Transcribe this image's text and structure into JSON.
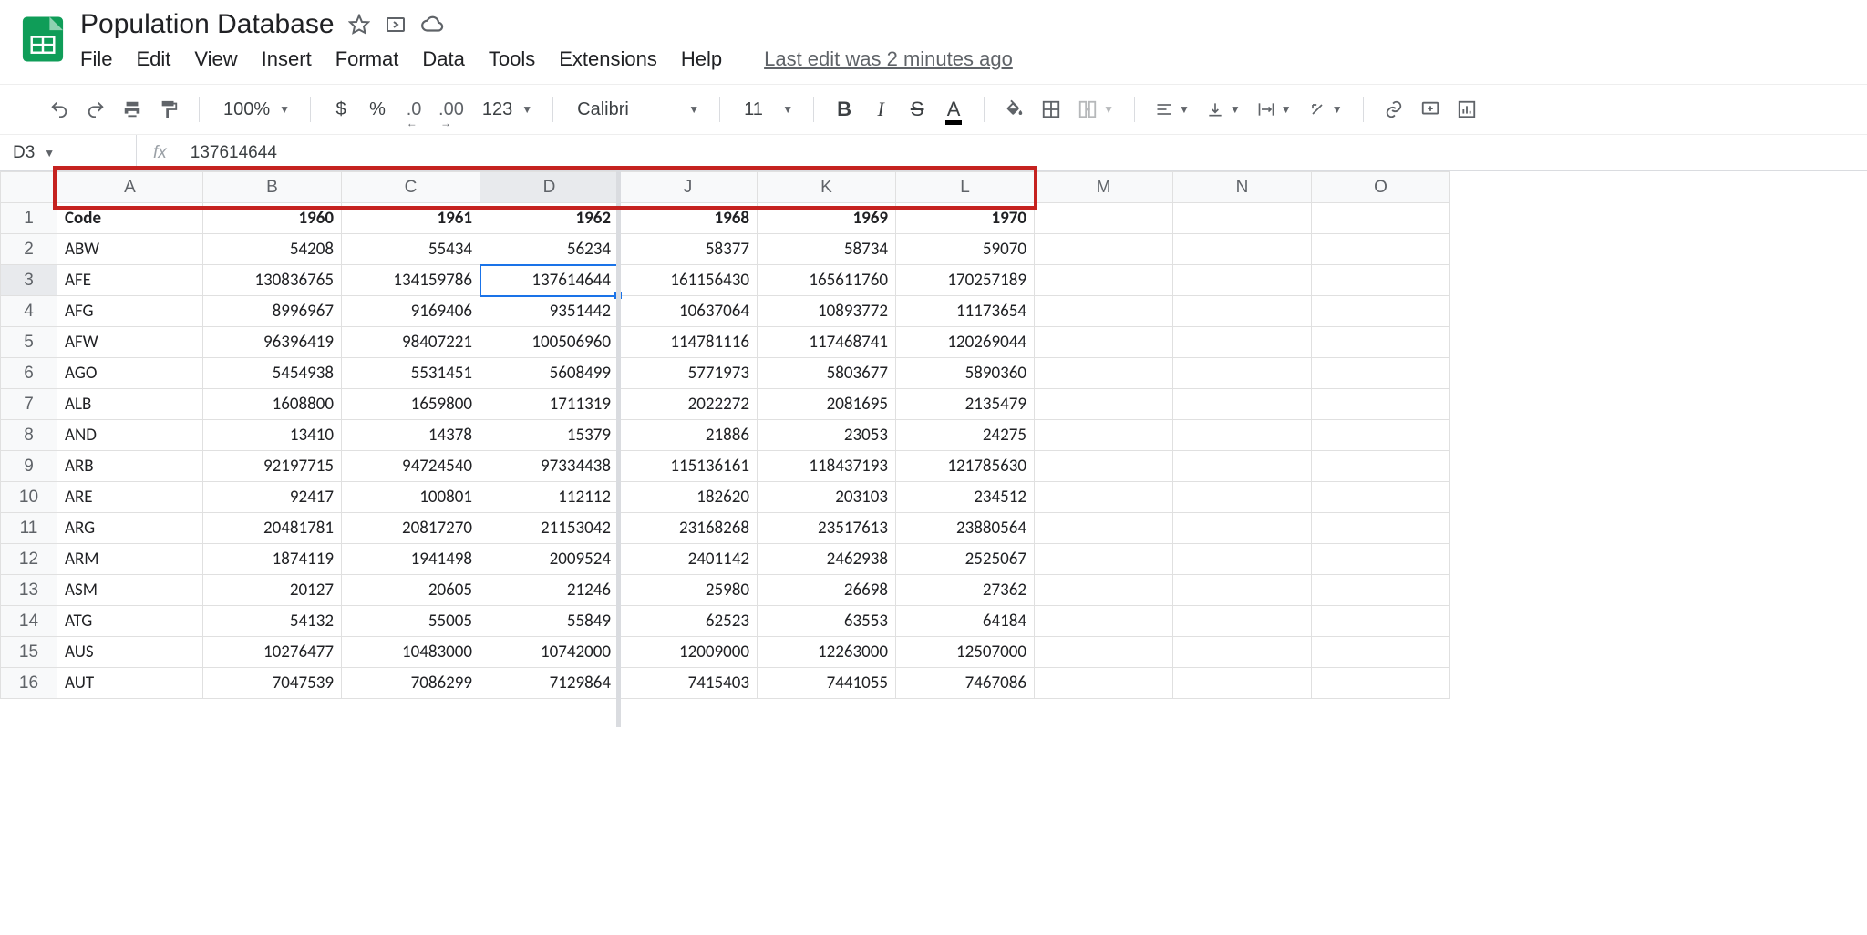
{
  "document": {
    "title": "Population Database",
    "last_edit": "Last edit was 2 minutes ago"
  },
  "menu": {
    "file": "File",
    "edit": "Edit",
    "view": "View",
    "insert": "Insert",
    "format": "Format",
    "data": "Data",
    "tools": "Tools",
    "extensions": "Extensions",
    "help": "Help"
  },
  "toolbar": {
    "zoom": "100%",
    "currency": "$",
    "percent": "%",
    "dec_dec": ".0",
    "inc_dec": ".00",
    "num_format": "123",
    "font": "Calibri",
    "font_size": "11"
  },
  "namebox": {
    "ref": "D3",
    "fx": "fx",
    "value": "137614644"
  },
  "columns": [
    "A",
    "B",
    "C",
    "D",
    "J",
    "K",
    "L",
    "M",
    "N",
    "O"
  ],
  "selected_col_index": 3,
  "selected_row_index": 2,
  "header_row": [
    "Code",
    "1960",
    "1961",
    "1962",
    "1968",
    "1969",
    "1970",
    "",
    "",
    ""
  ],
  "rows": [
    [
      "ABW",
      "54208",
      "55434",
      "56234",
      "58377",
      "58734",
      "59070",
      "",
      "",
      ""
    ],
    [
      "AFE",
      "130836765",
      "134159786",
      "137614644",
      "161156430",
      "165611760",
      "170257189",
      "",
      "",
      ""
    ],
    [
      "AFG",
      "8996967",
      "9169406",
      "9351442",
      "10637064",
      "10893772",
      "11173654",
      "",
      "",
      ""
    ],
    [
      "AFW",
      "96396419",
      "98407221",
      "100506960",
      "114781116",
      "117468741",
      "120269044",
      "",
      "",
      ""
    ],
    [
      "AGO",
      "5454938",
      "5531451",
      "5608499",
      "5771973",
      "5803677",
      "5890360",
      "",
      "",
      ""
    ],
    [
      "ALB",
      "1608800",
      "1659800",
      "1711319",
      "2022272",
      "2081695",
      "2135479",
      "",
      "",
      ""
    ],
    [
      "AND",
      "13410",
      "14378",
      "15379",
      "21886",
      "23053",
      "24275",
      "",
      "",
      ""
    ],
    [
      "ARB",
      "92197715",
      "94724540",
      "97334438",
      "115136161",
      "118437193",
      "121785630",
      "",
      "",
      ""
    ],
    [
      "ARE",
      "92417",
      "100801",
      "112112",
      "182620",
      "203103",
      "234512",
      "",
      "",
      ""
    ],
    [
      "ARG",
      "20481781",
      "20817270",
      "21153042",
      "23168268",
      "23517613",
      "23880564",
      "",
      "",
      ""
    ],
    [
      "ARM",
      "1874119",
      "1941498",
      "2009524",
      "2401142",
      "2462938",
      "2525067",
      "",
      "",
      ""
    ],
    [
      "ASM",
      "20127",
      "20605",
      "21246",
      "25980",
      "26698",
      "27362",
      "",
      "",
      ""
    ],
    [
      "ATG",
      "54132",
      "55005",
      "55849",
      "62523",
      "63553",
      "64184",
      "",
      "",
      ""
    ],
    [
      "AUS",
      "10276477",
      "10483000",
      "10742000",
      "12009000",
      "12263000",
      "12507000",
      "",
      "",
      ""
    ],
    [
      "AUT",
      "7047539",
      "7086299",
      "7129864",
      "7415403",
      "7441055",
      "7467086",
      "",
      "",
      ""
    ]
  ]
}
